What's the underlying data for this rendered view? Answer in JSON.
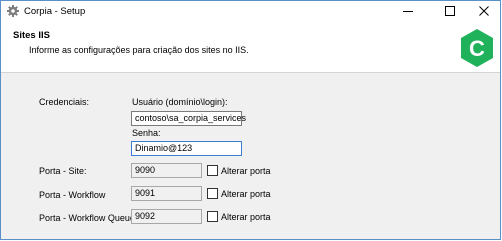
{
  "window": {
    "title": "Corpia - Setup",
    "logo_letter": "C",
    "brand_color": "#1fb25a"
  },
  "header": {
    "title": "Sites IIS",
    "subtitle": "Informe as configurações para criação dos sites no IIS."
  },
  "credentials": {
    "label": "Credenciais:",
    "user_label": "Usuário (domínio\\login):",
    "user_value": "contoso\\sa_corpia_services",
    "password_label": "Senha:",
    "password_value": "Dinamio@123"
  },
  "ports": [
    {
      "label": "Porta - Site:",
      "value": "9090",
      "alter_label": "Alterar porta"
    },
    {
      "label": "Porta - Workflow",
      "value": "9091",
      "alter_label": "Alterar porta"
    },
    {
      "label": "Porta - Workflow Queue:",
      "value": "9092",
      "alter_label": "Alterar porta"
    }
  ]
}
